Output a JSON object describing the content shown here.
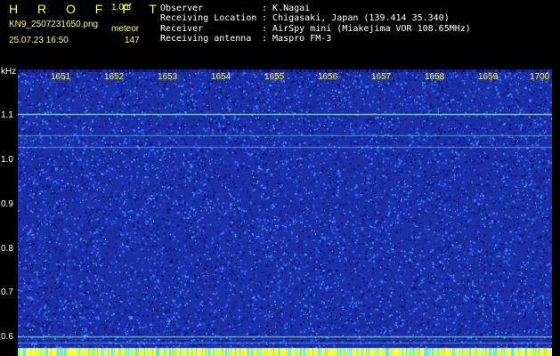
{
  "header": {
    "brand": "H R O F F T",
    "version": "1.00f",
    "filename": "KN9_2507231650.png",
    "meteor_label": "meteor",
    "datetime": "25.07.23 16:50",
    "count": "147"
  },
  "meta": [
    {
      "key": "Observer",
      "value": ": K.Nagai"
    },
    {
      "key": "Receiving Location",
      "value": ": Chigasaki, Japan (139.414 35.340)"
    },
    {
      "key": "Receiver",
      "value": ": AirSpy mini (Miakejima VOR 108.65MHz)"
    },
    {
      "key": "Receiving antenna",
      "value": ": Maspro FM-3"
    }
  ],
  "chart_data": {
    "type": "heatmap",
    "ylabel": "kHz",
    "x_ticks": [
      "1651",
      "1652",
      "1653",
      "1654",
      "1655",
      "1656",
      "1657",
      "1658",
      "1659",
      "1700"
    ],
    "y_ticks": [
      "1.1",
      "1.0",
      "0.9",
      "0.8",
      "0.7",
      "0.6"
    ],
    "ylim": [
      0.57,
      1.22
    ],
    "colors": {
      "background": "#1b2fa6",
      "noise": "#3c7cff",
      "signal": "#7fffd4",
      "peak": "#ffff3c"
    }
  }
}
